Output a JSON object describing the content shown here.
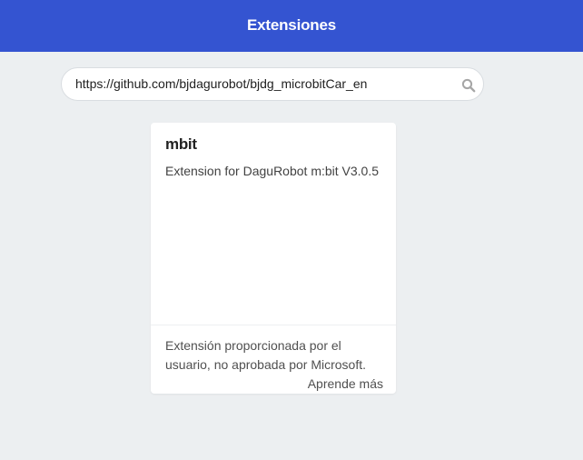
{
  "header": {
    "title": "Extensiones"
  },
  "search": {
    "value": "https://github.com/bjdagurobot/bjdg_microbitCar_en",
    "icon": "search-icon"
  },
  "results": [
    {
      "name": "mbit",
      "description": "Extension for DaguRobot m:bit V3.0.5",
      "footer_text": "Extensión proporcionada por el usuario, no aprobada por Microsoft.",
      "learn_more_label": "Aprende más"
    }
  ],
  "colors": {
    "header_bg": "#3454d1",
    "page_bg": "#eceff1",
    "card_bg": "#ffffff"
  }
}
